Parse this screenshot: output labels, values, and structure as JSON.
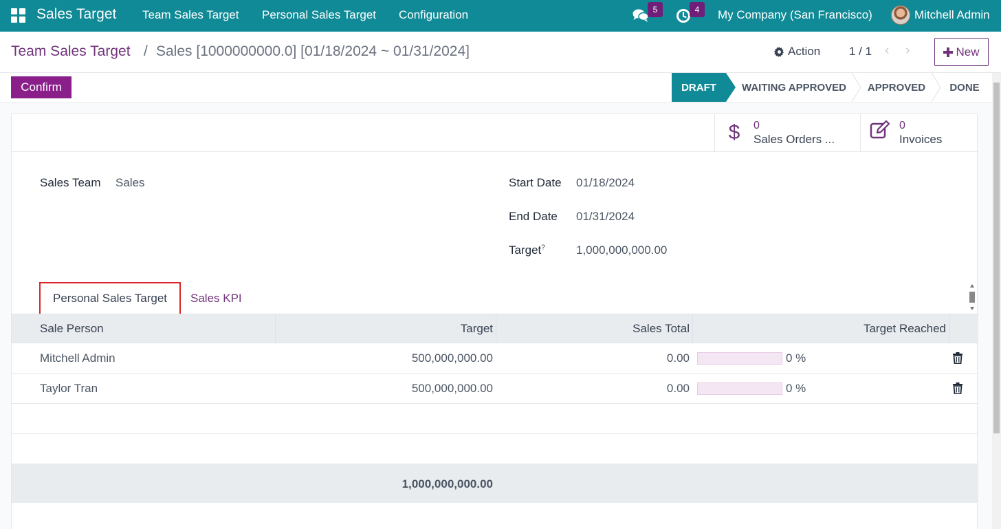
{
  "navbar": {
    "app_name": "Sales Target",
    "menus": [
      "Team Sales Target",
      "Personal Sales Target",
      "Configuration"
    ],
    "messages_count": "5",
    "activities_count": "4",
    "company": "My Company (San Francisco)",
    "user": "Mitchell Admin",
    "color": "#0f8a96"
  },
  "breadcrumb": {
    "root": "Team Sales Target",
    "separator": "/",
    "current": "Sales [1000000000.0] [01/18/2024 ~ 01/31/2024]"
  },
  "control": {
    "action_label": "Action",
    "pager": "1 / 1",
    "prev": "‹",
    "next": "›",
    "new_label": "New"
  },
  "statusbar": {
    "confirm_label": "Confirm",
    "stages": [
      "DRAFT",
      "WAITING APPROVED",
      "APPROVED",
      "DONE"
    ],
    "active_stage": "DRAFT"
  },
  "smart_buttons": [
    {
      "count": "0",
      "label": "Sales Orders ...",
      "icon": "dollar-icon"
    },
    {
      "count": "0",
      "label": "Invoices",
      "icon": "edit-icon"
    }
  ],
  "form": {
    "sales_team_label": "Sales Team",
    "sales_team_value": "Sales",
    "start_date_label": "Start Date",
    "start_date_value": "01/18/2024",
    "end_date_label": "End Date",
    "end_date_value": "01/31/2024",
    "target_label": "Target",
    "target_help": "?",
    "target_value": "1,000,000,000.00"
  },
  "tabs": [
    "Personal Sales Target",
    "Sales KPI"
  ],
  "table": {
    "headers": [
      "Sale Person",
      "Target",
      "Sales Total",
      "Target Reached"
    ],
    "rows": [
      {
        "person": "Mitchell Admin",
        "target": "500,000,000.00",
        "total": "0.00",
        "reached": "0 %",
        "reached_value": 0
      },
      {
        "person": "Taylor Tran",
        "target": "500,000,000.00",
        "total": "0.00",
        "reached": "0 %",
        "reached_value": 0
      }
    ],
    "footer_total": "1,000,000,000.00"
  },
  "colors": {
    "accent": "#71347c",
    "confirm": "#8a1f8a",
    "highlight_border": "#dc2626"
  }
}
